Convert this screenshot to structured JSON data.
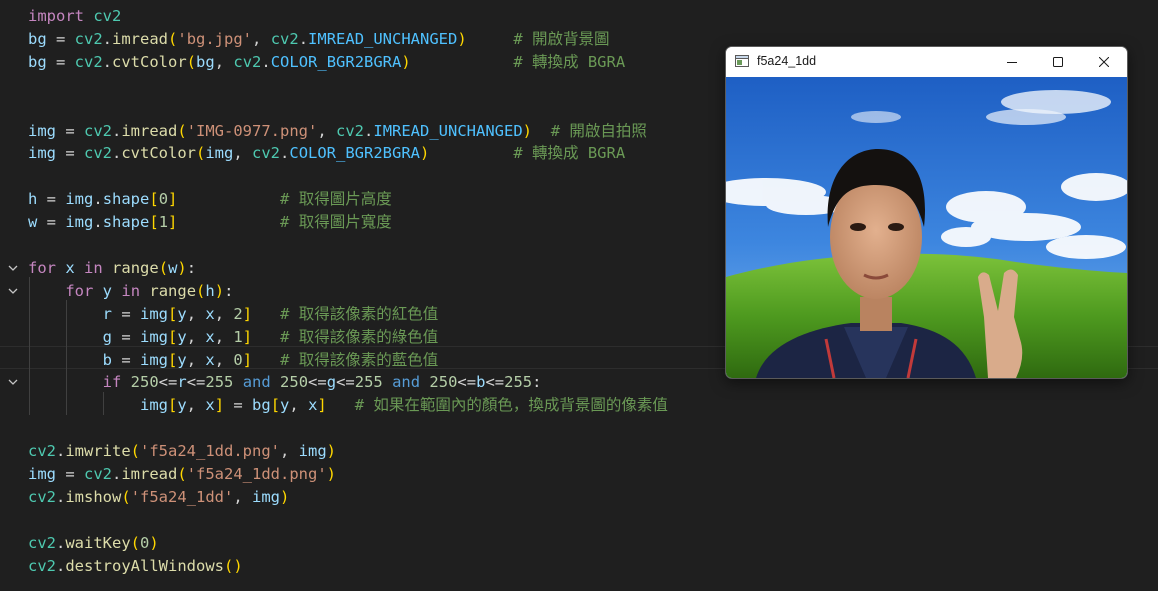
{
  "code": {
    "lines": [
      [
        [
          "import",
          "kw"
        ],
        [
          " ",
          "op"
        ],
        [
          "cv2",
          "mod"
        ]
      ],
      [
        [
          "bg",
          "var"
        ],
        [
          " = ",
          "op"
        ],
        [
          "cv2",
          "mod"
        ],
        [
          ".",
          "op"
        ],
        [
          "imread",
          "fn"
        ],
        [
          "(",
          "bracket1"
        ],
        [
          "'bg.jpg'",
          "str"
        ],
        [
          ", ",
          "op"
        ],
        [
          "cv2",
          "mod"
        ],
        [
          ".",
          "op"
        ],
        [
          "IMREAD_UNCHANGED",
          "const"
        ],
        [
          ")",
          "bracket1"
        ],
        [
          "     ",
          "op"
        ],
        [
          "# 開啟背景圖",
          "com"
        ]
      ],
      [
        [
          "bg",
          "var"
        ],
        [
          " = ",
          "op"
        ],
        [
          "cv2",
          "mod"
        ],
        [
          ".",
          "op"
        ],
        [
          "cvtColor",
          "fn"
        ],
        [
          "(",
          "bracket1"
        ],
        [
          "bg",
          "var"
        ],
        [
          ", ",
          "op"
        ],
        [
          "cv2",
          "mod"
        ],
        [
          ".",
          "op"
        ],
        [
          "COLOR_BGR2BGRA",
          "const"
        ],
        [
          ")",
          "bracket1"
        ],
        [
          "           ",
          "op"
        ],
        [
          "# 轉換成 BGRA",
          "com"
        ]
      ],
      [],
      [],
      [
        [
          "img",
          "var"
        ],
        [
          " = ",
          "op"
        ],
        [
          "cv2",
          "mod"
        ],
        [
          ".",
          "op"
        ],
        [
          "imread",
          "fn"
        ],
        [
          "(",
          "bracket1"
        ],
        [
          "'IMG-0977.png'",
          "str"
        ],
        [
          ", ",
          "op"
        ],
        [
          "cv2",
          "mod"
        ],
        [
          ".",
          "op"
        ],
        [
          "IMREAD_UNCHANGED",
          "const"
        ],
        [
          ")",
          "bracket1"
        ],
        [
          "  ",
          "op"
        ],
        [
          "# 開啟自拍照",
          "com"
        ]
      ],
      [
        [
          "img",
          "var"
        ],
        [
          " = ",
          "op"
        ],
        [
          "cv2",
          "mod"
        ],
        [
          ".",
          "op"
        ],
        [
          "cvtColor",
          "fn"
        ],
        [
          "(",
          "bracket1"
        ],
        [
          "img",
          "var"
        ],
        [
          ", ",
          "op"
        ],
        [
          "cv2",
          "mod"
        ],
        [
          ".",
          "op"
        ],
        [
          "COLOR_BGR2BGRA",
          "const"
        ],
        [
          ")",
          "bracket1"
        ],
        [
          "         ",
          "op"
        ],
        [
          "# 轉換成 BGRA",
          "com"
        ]
      ],
      [],
      [
        [
          "h",
          "var"
        ],
        [
          " = ",
          "op"
        ],
        [
          "img",
          "var"
        ],
        [
          ".",
          "op"
        ],
        [
          "shape",
          "var"
        ],
        [
          "[",
          "bracket1"
        ],
        [
          "0",
          "num"
        ],
        [
          "]",
          "bracket1"
        ],
        [
          "           ",
          "op"
        ],
        [
          "# 取得圖片高度",
          "com"
        ]
      ],
      [
        [
          "w",
          "var"
        ],
        [
          " = ",
          "op"
        ],
        [
          "img",
          "var"
        ],
        [
          ".",
          "op"
        ],
        [
          "shape",
          "var"
        ],
        [
          "[",
          "bracket1"
        ],
        [
          "1",
          "num"
        ],
        [
          "]",
          "bracket1"
        ],
        [
          "           ",
          "op"
        ],
        [
          "# 取得圖片寬度",
          "com"
        ]
      ],
      [],
      [
        [
          "for",
          "ctl"
        ],
        [
          " ",
          "op"
        ],
        [
          "x",
          "var"
        ],
        [
          " ",
          "op"
        ],
        [
          "in",
          "ctl"
        ],
        [
          " ",
          "op"
        ],
        [
          "range",
          "fn"
        ],
        [
          "(",
          "bracket1"
        ],
        [
          "w",
          "var"
        ],
        [
          ")",
          "bracket1"
        ],
        [
          ":",
          "op"
        ]
      ],
      [
        [
          "    ",
          "op"
        ],
        [
          "for",
          "ctl"
        ],
        [
          " ",
          "op"
        ],
        [
          "y",
          "var"
        ],
        [
          " ",
          "op"
        ],
        [
          "in",
          "ctl"
        ],
        [
          " ",
          "op"
        ],
        [
          "range",
          "fn"
        ],
        [
          "(",
          "bracket1"
        ],
        [
          "h",
          "var"
        ],
        [
          ")",
          "bracket1"
        ],
        [
          ":",
          "op"
        ]
      ],
      [
        [
          "        ",
          "op"
        ],
        [
          "r",
          "var"
        ],
        [
          " = ",
          "op"
        ],
        [
          "img",
          "var"
        ],
        [
          "[",
          "bracket1"
        ],
        [
          "y",
          "var"
        ],
        [
          ", ",
          "op"
        ],
        [
          "x",
          "var"
        ],
        [
          ", ",
          "op"
        ],
        [
          "2",
          "num"
        ],
        [
          "]",
          "bracket1"
        ],
        [
          "   ",
          "op"
        ],
        [
          "# 取得該像素的紅色值",
          "com"
        ]
      ],
      [
        [
          "        ",
          "op"
        ],
        [
          "g",
          "var"
        ],
        [
          " = ",
          "op"
        ],
        [
          "img",
          "var"
        ],
        [
          "[",
          "bracket1"
        ],
        [
          "y",
          "var"
        ],
        [
          ", ",
          "op"
        ],
        [
          "x",
          "var"
        ],
        [
          ", ",
          "op"
        ],
        [
          "1",
          "num"
        ],
        [
          "]",
          "bracket1"
        ],
        [
          "   ",
          "op"
        ],
        [
          "# 取得該像素的綠色值",
          "com"
        ]
      ],
      [
        [
          "        ",
          "op"
        ],
        [
          "b",
          "var"
        ],
        [
          " = ",
          "op"
        ],
        [
          "img",
          "var"
        ],
        [
          "[",
          "bracket1"
        ],
        [
          "y",
          "var"
        ],
        [
          ", ",
          "op"
        ],
        [
          "x",
          "var"
        ],
        [
          ", ",
          "op"
        ],
        [
          "0",
          "num"
        ],
        [
          "]",
          "bracket1"
        ],
        [
          "   ",
          "op"
        ],
        [
          "# 取得該像素的藍色值",
          "com"
        ]
      ],
      [
        [
          "        ",
          "op"
        ],
        [
          "if",
          "ctl"
        ],
        [
          " ",
          "op"
        ],
        [
          "250",
          "num"
        ],
        [
          "<=",
          "op"
        ],
        [
          "r",
          "var"
        ],
        [
          "<=",
          "op"
        ],
        [
          "255",
          "num"
        ],
        [
          " ",
          "op"
        ],
        [
          "and",
          "and"
        ],
        [
          " ",
          "op"
        ],
        [
          "250",
          "num"
        ],
        [
          "<=",
          "op"
        ],
        [
          "g",
          "var"
        ],
        [
          "<=",
          "op"
        ],
        [
          "255",
          "num"
        ],
        [
          " ",
          "op"
        ],
        [
          "and",
          "and"
        ],
        [
          " ",
          "op"
        ],
        [
          "250",
          "num"
        ],
        [
          "<=",
          "op"
        ],
        [
          "b",
          "var"
        ],
        [
          "<=",
          "op"
        ],
        [
          "255",
          "num"
        ],
        [
          ":",
          "op"
        ]
      ],
      [
        [
          "            ",
          "op"
        ],
        [
          "img",
          "var"
        ],
        [
          "[",
          "bracket1"
        ],
        [
          "y",
          "var"
        ],
        [
          ", ",
          "op"
        ],
        [
          "x",
          "var"
        ],
        [
          "]",
          "bracket1"
        ],
        [
          " = ",
          "op"
        ],
        [
          "bg",
          "var"
        ],
        [
          "[",
          "bracket1"
        ],
        [
          "y",
          "var"
        ],
        [
          ", ",
          "op"
        ],
        [
          "x",
          "var"
        ],
        [
          "]",
          "bracket1"
        ],
        [
          "   ",
          "op"
        ],
        [
          "# 如果在範圍內的顏色，換成背景圖的像素值",
          "com"
        ]
      ],
      [],
      [
        [
          "cv2",
          "mod"
        ],
        [
          ".",
          "op"
        ],
        [
          "imwrite",
          "fn"
        ],
        [
          "(",
          "bracket1"
        ],
        [
          "'f5a24_1dd.png'",
          "str"
        ],
        [
          ", ",
          "op"
        ],
        [
          "img",
          "var"
        ],
        [
          ")",
          "bracket1"
        ]
      ],
      [
        [
          "img",
          "var"
        ],
        [
          " = ",
          "op"
        ],
        [
          "cv2",
          "mod"
        ],
        [
          ".",
          "op"
        ],
        [
          "imread",
          "fn"
        ],
        [
          "(",
          "bracket1"
        ],
        [
          "'f5a24_1dd.png'",
          "str"
        ],
        [
          ")",
          "bracket1"
        ]
      ],
      [
        [
          "cv2",
          "mod"
        ],
        [
          ".",
          "op"
        ],
        [
          "imshow",
          "fn"
        ],
        [
          "(",
          "bracket1"
        ],
        [
          "'f5a24_1dd'",
          "str"
        ],
        [
          ", ",
          "op"
        ],
        [
          "img",
          "var"
        ],
        [
          ")",
          "bracket1"
        ]
      ],
      [],
      [
        [
          "cv2",
          "mod"
        ],
        [
          ".",
          "op"
        ],
        [
          "waitKey",
          "fn"
        ],
        [
          "(",
          "bracket1"
        ],
        [
          "0",
          "num"
        ],
        [
          ")",
          "bracket1"
        ]
      ],
      [
        [
          "cv2",
          "mod"
        ],
        [
          ".",
          "op"
        ],
        [
          "destroyAllWindows",
          "fn"
        ],
        [
          "(",
          "bracket1"
        ],
        [
          ")",
          "bracket1"
        ]
      ]
    ],
    "fold_lines": [
      11,
      12,
      16
    ]
  },
  "window": {
    "title": "f5a24_1dd",
    "icons": [
      "app-window-icon",
      "minimize-icon",
      "maximize-icon",
      "close-icon"
    ]
  },
  "colors": {
    "editor_bg": "#1f1f1f",
    "keyword": "#c586c0",
    "module": "#4ec9b0",
    "variable": "#9cdcfe",
    "function": "#dcdcaa",
    "string": "#ce9178",
    "number": "#b5cea8",
    "constant": "#4fc1ff",
    "comment": "#6a9955"
  }
}
